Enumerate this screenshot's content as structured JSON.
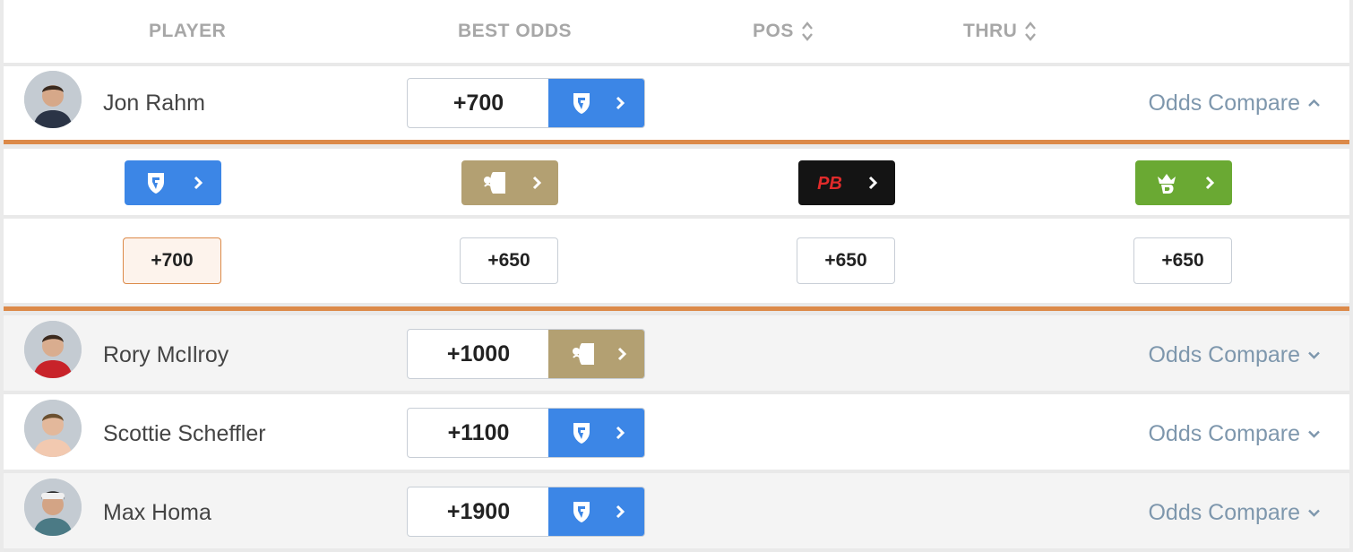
{
  "header": {
    "player": "PLAYER",
    "best_odds": "BEST ODDS",
    "pos": "POS",
    "thru": "THRU"
  },
  "colors": {
    "fanduel": "#3c86e6",
    "betmgm": "#b3a072",
    "pointsbet": "#141414",
    "draftkings": "#6aa933",
    "highlight": "#dc8a49",
    "link": "#7e97ad"
  },
  "players": [
    {
      "name": "Jon Rahm",
      "best_odds": "+700",
      "book": "fanduel",
      "compare_label": "Odds Compare",
      "expanded": true,
      "shirt": "#2b3446",
      "hair": "#3a2a1f"
    },
    {
      "name": "Rory McIlroy",
      "best_odds": "+1000",
      "book": "betmgm",
      "compare_label": "Odds Compare",
      "expanded": false,
      "shirt": "#c8232a",
      "hair": "#3b2a1e"
    },
    {
      "name": "Scottie Scheffler",
      "best_odds": "+1100",
      "book": "fanduel",
      "compare_label": "Odds Compare",
      "expanded": false,
      "shirt": "#f2c9b0",
      "hair": "#6b5030"
    },
    {
      "name": "Max Homa",
      "best_odds": "+1900",
      "book": "fanduel",
      "compare_label": "Odds Compare",
      "expanded": false,
      "shirt": "#4b7a85",
      "hair": "#2a2a2a"
    }
  ],
  "expanded_odds": {
    "books": [
      {
        "name": "fanduel",
        "icon": "fanduel-shield-icon"
      },
      {
        "name": "betmgm",
        "icon": "betmgm-lion-icon"
      },
      {
        "name": "pointsbet",
        "icon": "pointsbet-logo",
        "logo_text": "PB"
      },
      {
        "name": "draftkings",
        "icon": "draftkings-crown-icon"
      }
    ],
    "values": [
      "+700",
      "+650",
      "+650",
      "+650"
    ],
    "best_index": 0
  }
}
